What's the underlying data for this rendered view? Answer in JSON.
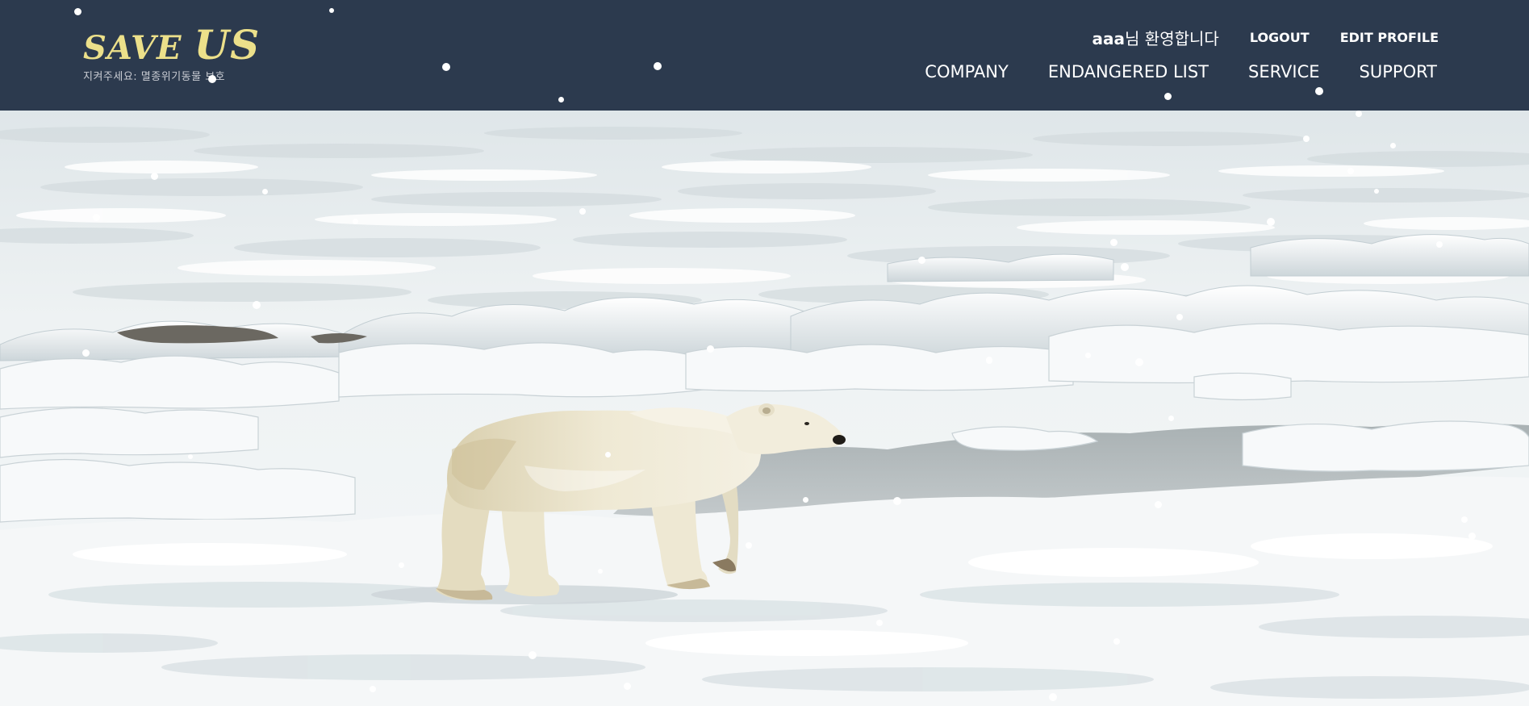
{
  "header": {
    "logo": {
      "title_part1": "SAVE ",
      "title_part2": "US",
      "subtitle": "지켜주세요: 멸종위기동물 보호"
    },
    "user_bar": {
      "user_name": "aaa",
      "welcome_suffix": "님 환영합니다",
      "logout_label": "LOGOUT",
      "edit_profile_label": "EDIT PROFILE"
    },
    "nav": {
      "items": [
        {
          "label": "COMPANY"
        },
        {
          "label": "ENDANGERED LIST"
        },
        {
          "label": "SERVICE"
        },
        {
          "label": "SUPPORT"
        }
      ]
    }
  },
  "hero": {
    "image_subject": "polar-bear-on-sea-ice"
  },
  "colors": {
    "header_bg": "#2c3a4e",
    "logo_yellow": "#ece08a",
    "nav_text": "#ffffff"
  }
}
